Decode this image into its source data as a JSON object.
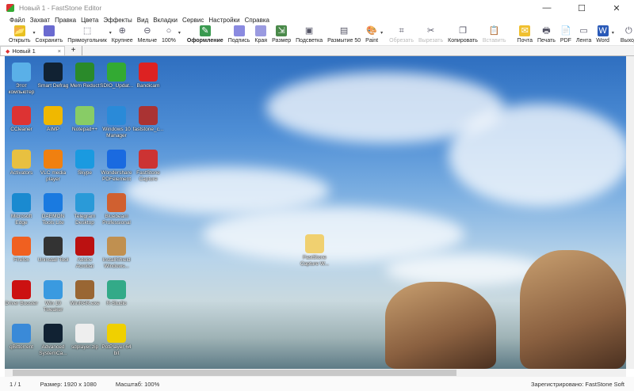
{
  "window": {
    "title": "Новый 1 - FastStone Editor",
    "controls": [
      "—",
      "☐",
      "✕"
    ]
  },
  "menu": [
    "Файл",
    "Захват",
    "Правка",
    "Цвета",
    "Эффекты",
    "Вид",
    "Вкладки",
    "Сервис",
    "Настройки",
    "Справка"
  ],
  "toolbar": [
    {
      "label": "Открыть",
      "icon": "folder-icon",
      "color": "#e8c020",
      "glyph": "📂",
      "dd": true
    },
    {
      "label": "Сохранить",
      "icon": "save-icon",
      "color": "#6a6ad0",
      "glyph": ""
    },
    {
      "label": "Прямоугольник",
      "icon": "rectangle-select-icon",
      "color": "#fff",
      "glyph": "⬚",
      "dd": true
    },
    {
      "label": "Крупнее",
      "icon": "zoom-in-icon",
      "color": "#fff",
      "glyph": "⊕"
    },
    {
      "label": "Мельче",
      "icon": "zoom-out-icon",
      "color": "#fff",
      "glyph": "⊖"
    },
    {
      "label": "100%",
      "icon": "zoom-icon",
      "color": "#fff",
      "glyph": "○",
      "dd": true
    },
    {
      "sep": true
    },
    {
      "label": "Оформление",
      "icon": "draw-icon",
      "color": "#3a9a50",
      "glyph": "✎",
      "bold": true
    },
    {
      "label": "Подпись",
      "icon": "caption-icon",
      "color": "#8a8ae0",
      "glyph": ""
    },
    {
      "label": "Края",
      "icon": "edge-icon",
      "color": "#9a9ae0",
      "glyph": ""
    },
    {
      "label": "Размер",
      "icon": "resize-icon",
      "color": "#4a8a4a",
      "glyph": "⇲"
    },
    {
      "label": "Подсветка",
      "icon": "spotlight-icon",
      "color": "#fff",
      "glyph": "▣"
    },
    {
      "label": "Размытие 50",
      "icon": "blur-icon",
      "color": "#fff",
      "glyph": "▤"
    },
    {
      "label": "Paint",
      "icon": "paint-icon",
      "color": "#fff",
      "glyph": "🎨",
      "dd": true
    },
    {
      "sep": true
    },
    {
      "label": "Обрезать",
      "icon": "crop-icon",
      "color": "#fff",
      "glyph": "⌗",
      "disabled": true
    },
    {
      "label": "Вырезать",
      "icon": "cut-icon",
      "color": "#fff",
      "glyph": "✂",
      "disabled": true
    },
    {
      "label": "Копировать",
      "icon": "copy-icon",
      "color": "#fff",
      "glyph": "❐"
    },
    {
      "label": "Вставить",
      "icon": "paste-icon",
      "color": "#fff",
      "glyph": "📋",
      "disabled": true
    },
    {
      "sep": true
    },
    {
      "label": "Почта",
      "icon": "mail-icon",
      "color": "#f0c030",
      "glyph": "✉"
    },
    {
      "label": "Печать",
      "icon": "print-icon",
      "color": "#fff",
      "glyph": "🖶"
    },
    {
      "label": "PDF",
      "icon": "pdf-icon",
      "color": "#fff",
      "glyph": "📄"
    },
    {
      "label": "Лента",
      "icon": "ribbon-icon",
      "color": "#fff",
      "glyph": "▭"
    },
    {
      "label": "Word",
      "icon": "word-icon",
      "color": "#2a5ab8",
      "glyph": "W",
      "dd": true
    },
    {
      "sep": true
    },
    {
      "label": "Выход",
      "icon": "power-icon",
      "color": "#fff",
      "glyph": "⏻"
    }
  ],
  "tabs": {
    "active": "Новый 1",
    "close": "×",
    "add": "+"
  },
  "desktop": [
    [
      {
        "l": "Этот компьютер",
        "c": "#5ab0e8"
      },
      {
        "l": "Smart Defrag",
        "c": "#123"
      },
      {
        "l": "Mem Reduct",
        "c": "#2a8a2a"
      },
      {
        "l": "SDIO_Updat...",
        "c": "#3a3"
      },
      {
        "l": "Bandicam",
        "c": "#d22"
      }
    ],
    [
      {
        "l": "CCleaner",
        "c": "#d33"
      },
      {
        "l": "AIMP",
        "c": "#f0b800"
      },
      {
        "l": "Notepad++",
        "c": "#8c6"
      },
      {
        "l": "Windows 10 Manager",
        "c": "#2a8ad8"
      },
      {
        "l": "faststone_c...",
        "c": "#a33"
      }
    ],
    [
      {
        "l": "Activators",
        "c": "#e8c040"
      },
      {
        "l": "VLC media player",
        "c": "#f08010"
      },
      {
        "l": "Skype",
        "c": "#1a9ae0"
      },
      {
        "l": "Wondershare PDFelement",
        "c": "#1a6ae0"
      },
      {
        "l": "FastStone Capture",
        "c": "#c33"
      }
    ],
    [
      {
        "l": "Microsoft Edge",
        "c": "#1a8ad0"
      },
      {
        "l": "DAEMON Tools Lite",
        "c": "#1a7ae0"
      },
      {
        "l": "Telegram Desktop",
        "c": "#2a9ad8"
      },
      {
        "l": "Bluebeam Professional",
        "c": "#d06030"
      }
    ],
    [
      {
        "l": "Firefox",
        "c": "#f06020"
      },
      {
        "l": "Uninstall Tool",
        "c": "#333"
      },
      {
        "l": "Adobe Acrobat",
        "c": "#b11"
      },
      {
        "l": "InstallShield Windows...",
        "c": "#c09050"
      }
    ],
    [
      {
        "l": "Driver Booster",
        "c": "#c11"
      },
      {
        "l": "Win 10 Tweaker",
        "c": "#3a9ae0"
      },
      {
        "l": "WinRAR.exe",
        "c": "#963"
      },
      {
        "l": "R-Studio",
        "c": "#3a8"
      }
    ],
    [
      {
        "l": "qBittorrent",
        "c": "#3a8ad8"
      },
      {
        "l": "Advanced SystemCa...",
        "c": "#123"
      },
      {
        "l": "sdplayer.zip",
        "c": "#eee"
      },
      {
        "l": "PotPlayer 64 bit",
        "c": "#f0d000"
      }
    ]
  ],
  "desktop_center_icon": "FastStone Capture W...",
  "status": {
    "page": "1 / 1",
    "size": "Размер: 1920 x 1080",
    "zoom": "Масштаб: 100%",
    "registered": "Зарегистрировано: FastStone Soft"
  }
}
